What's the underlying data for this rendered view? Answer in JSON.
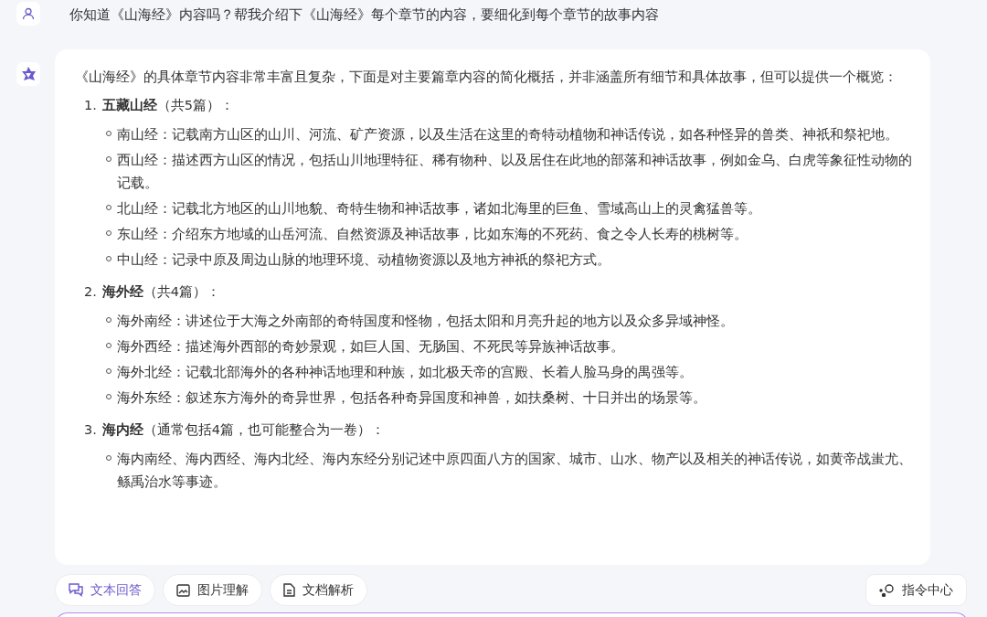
{
  "question": "你知道《山海经》内容吗？帮我介绍下《山海经》每个章节的内容，要细化到每个章节的故事内容",
  "answer": {
    "intro": "《山海经》的具体章节内容非常丰富且复杂，下面是对主要篇章内容的简化概括，并非涵盖所有细节和具体故事，但可以提供一个概览：",
    "sections": [
      {
        "number": "1.",
        "heading": "**五藏山经**（共5篇）：",
        "items": [
          "南山经：记载南方山区的山川、河流、矿产资源，以及生活在这里的奇特动植物和神话传说，如各种怪异的兽类、神祇和祭祀地。",
          "西山经：描述西方山区的情况，包括山川地理特征、稀有物种、以及居住在此地的部落和神话故事，例如金乌、白虎等象征性动物的记载。",
          "北山经：记载北方地区的山川地貌、奇特生物和神话故事，诸如北海里的巨鱼、雪域高山上的灵禽猛兽等。",
          "东山经：介绍东方地域的山岳河流、自然资源及神话故事，比如东海的不死药、食之令人长寿的桃树等。",
          "中山经：记录中原及周边山脉的地理环境、动植物资源以及地方神祇的祭祀方式。"
        ]
      },
      {
        "number": "2.",
        "heading": "**海外经**（共4篇）：",
        "items": [
          "海外南经：讲述位于大海之外南部的奇特国度和怪物，包括太阳和月亮升起的地方以及众多异域神怪。",
          "海外西经：描述海外西部的奇妙景观，如巨人国、无肠国、不死民等异族神话故事。",
          "海外北经：记载北部海外的各种神话地理和种族，如北极天帝的宫殿、长着人脸马身的禺强等。",
          "海外东经：叙述东方海外的奇异世界，包括各种奇异国度和神兽，如扶桑树、十日并出的场景等。"
        ]
      },
      {
        "number": "3.",
        "heading": "**海内经**（通常包括4篇，也可能整合为一卷）：",
        "items": [
          "海内南经、海内西经、海内北经、海内东经分别记述中原四面八方的国家、城市、山水、物产以及相关的神话传说，如黄帝战蚩尤、鲧禹治水等事迹。"
        ]
      }
    ]
  },
  "toolbar": [
    {
      "kind": "chat",
      "label": "文本回答",
      "selected": true
    },
    {
      "kind": "image",
      "label": "图片理解",
      "selected": false
    },
    {
      "kind": "doc",
      "label": "文档解析",
      "selected": false
    }
  ],
  "command_button": "指令中心"
}
